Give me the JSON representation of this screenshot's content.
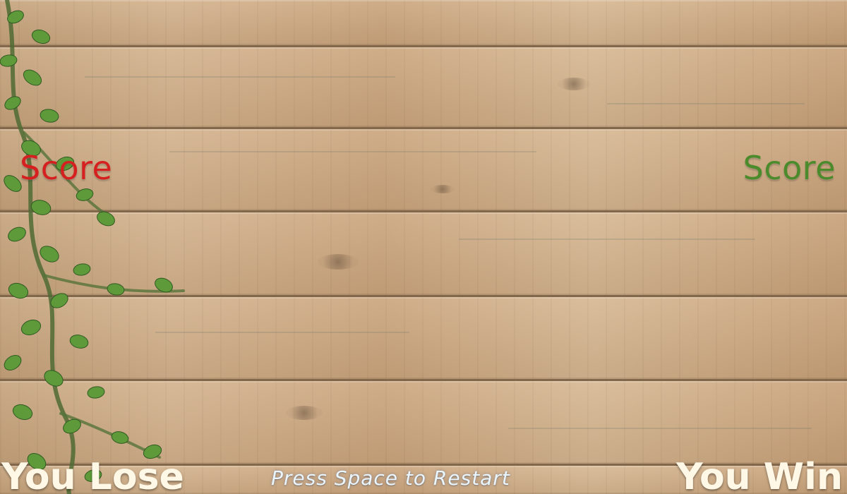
{
  "hud": {
    "left_score_label": "Score",
    "right_score_label": "Score",
    "left_result": "You Lose",
    "right_result": "You Win",
    "restart_hint": "Press Space to Restart"
  },
  "colors": {
    "left_score": "#d61f1f",
    "right_score": "#4b8b2b",
    "result_text": "#fff8e6",
    "restart_text": "#eaf6ff",
    "wood": "#c9a57b",
    "seam": "#4a3625",
    "leaf": "#5f9a3a"
  },
  "icons": {
    "background": "wood-planks",
    "decoration": "ivy-vine-icon"
  }
}
